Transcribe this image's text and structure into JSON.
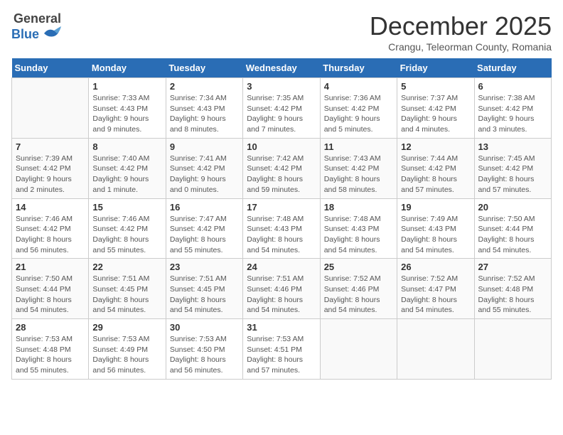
{
  "logo": {
    "general": "General",
    "blue": "Blue"
  },
  "title": "December 2025",
  "subtitle": "Crangu, Teleorman County, Romania",
  "days_header": [
    "Sunday",
    "Monday",
    "Tuesday",
    "Wednesday",
    "Thursday",
    "Friday",
    "Saturday"
  ],
  "weeks": [
    [
      {
        "day": "",
        "text": ""
      },
      {
        "day": "1",
        "text": "Sunrise: 7:33 AM\nSunset: 4:43 PM\nDaylight: 9 hours\nand 9 minutes."
      },
      {
        "day": "2",
        "text": "Sunrise: 7:34 AM\nSunset: 4:43 PM\nDaylight: 9 hours\nand 8 minutes."
      },
      {
        "day": "3",
        "text": "Sunrise: 7:35 AM\nSunset: 4:42 PM\nDaylight: 9 hours\nand 7 minutes."
      },
      {
        "day": "4",
        "text": "Sunrise: 7:36 AM\nSunset: 4:42 PM\nDaylight: 9 hours\nand 5 minutes."
      },
      {
        "day": "5",
        "text": "Sunrise: 7:37 AM\nSunset: 4:42 PM\nDaylight: 9 hours\nand 4 minutes."
      },
      {
        "day": "6",
        "text": "Sunrise: 7:38 AM\nSunset: 4:42 PM\nDaylight: 9 hours\nand 3 minutes."
      }
    ],
    [
      {
        "day": "7",
        "text": "Sunrise: 7:39 AM\nSunset: 4:42 PM\nDaylight: 9 hours\nand 2 minutes."
      },
      {
        "day": "8",
        "text": "Sunrise: 7:40 AM\nSunset: 4:42 PM\nDaylight: 9 hours\nand 1 minute."
      },
      {
        "day": "9",
        "text": "Sunrise: 7:41 AM\nSunset: 4:42 PM\nDaylight: 9 hours\nand 0 minutes."
      },
      {
        "day": "10",
        "text": "Sunrise: 7:42 AM\nSunset: 4:42 PM\nDaylight: 8 hours\nand 59 minutes."
      },
      {
        "day": "11",
        "text": "Sunrise: 7:43 AM\nSunset: 4:42 PM\nDaylight: 8 hours\nand 58 minutes."
      },
      {
        "day": "12",
        "text": "Sunrise: 7:44 AM\nSunset: 4:42 PM\nDaylight: 8 hours\nand 57 minutes."
      },
      {
        "day": "13",
        "text": "Sunrise: 7:45 AM\nSunset: 4:42 PM\nDaylight: 8 hours\nand 57 minutes."
      }
    ],
    [
      {
        "day": "14",
        "text": "Sunrise: 7:46 AM\nSunset: 4:42 PM\nDaylight: 8 hours\nand 56 minutes."
      },
      {
        "day": "15",
        "text": "Sunrise: 7:46 AM\nSunset: 4:42 PM\nDaylight: 8 hours\nand 55 minutes."
      },
      {
        "day": "16",
        "text": "Sunrise: 7:47 AM\nSunset: 4:42 PM\nDaylight: 8 hours\nand 55 minutes."
      },
      {
        "day": "17",
        "text": "Sunrise: 7:48 AM\nSunset: 4:43 PM\nDaylight: 8 hours\nand 54 minutes."
      },
      {
        "day": "18",
        "text": "Sunrise: 7:48 AM\nSunset: 4:43 PM\nDaylight: 8 hours\nand 54 minutes."
      },
      {
        "day": "19",
        "text": "Sunrise: 7:49 AM\nSunset: 4:43 PM\nDaylight: 8 hours\nand 54 minutes."
      },
      {
        "day": "20",
        "text": "Sunrise: 7:50 AM\nSunset: 4:44 PM\nDaylight: 8 hours\nand 54 minutes."
      }
    ],
    [
      {
        "day": "21",
        "text": "Sunrise: 7:50 AM\nSunset: 4:44 PM\nDaylight: 8 hours\nand 54 minutes."
      },
      {
        "day": "22",
        "text": "Sunrise: 7:51 AM\nSunset: 4:45 PM\nDaylight: 8 hours\nand 54 minutes."
      },
      {
        "day": "23",
        "text": "Sunrise: 7:51 AM\nSunset: 4:45 PM\nDaylight: 8 hours\nand 54 minutes."
      },
      {
        "day": "24",
        "text": "Sunrise: 7:51 AM\nSunset: 4:46 PM\nDaylight: 8 hours\nand 54 minutes."
      },
      {
        "day": "25",
        "text": "Sunrise: 7:52 AM\nSunset: 4:46 PM\nDaylight: 8 hours\nand 54 minutes."
      },
      {
        "day": "26",
        "text": "Sunrise: 7:52 AM\nSunset: 4:47 PM\nDaylight: 8 hours\nand 54 minutes."
      },
      {
        "day": "27",
        "text": "Sunrise: 7:52 AM\nSunset: 4:48 PM\nDaylight: 8 hours\nand 55 minutes."
      }
    ],
    [
      {
        "day": "28",
        "text": "Sunrise: 7:53 AM\nSunset: 4:48 PM\nDaylight: 8 hours\nand 55 minutes."
      },
      {
        "day": "29",
        "text": "Sunrise: 7:53 AM\nSunset: 4:49 PM\nDaylight: 8 hours\nand 56 minutes."
      },
      {
        "day": "30",
        "text": "Sunrise: 7:53 AM\nSunset: 4:50 PM\nDaylight: 8 hours\nand 56 minutes."
      },
      {
        "day": "31",
        "text": "Sunrise: 7:53 AM\nSunset: 4:51 PM\nDaylight: 8 hours\nand 57 minutes."
      },
      {
        "day": "",
        "text": ""
      },
      {
        "day": "",
        "text": ""
      },
      {
        "day": "",
        "text": ""
      }
    ]
  ]
}
